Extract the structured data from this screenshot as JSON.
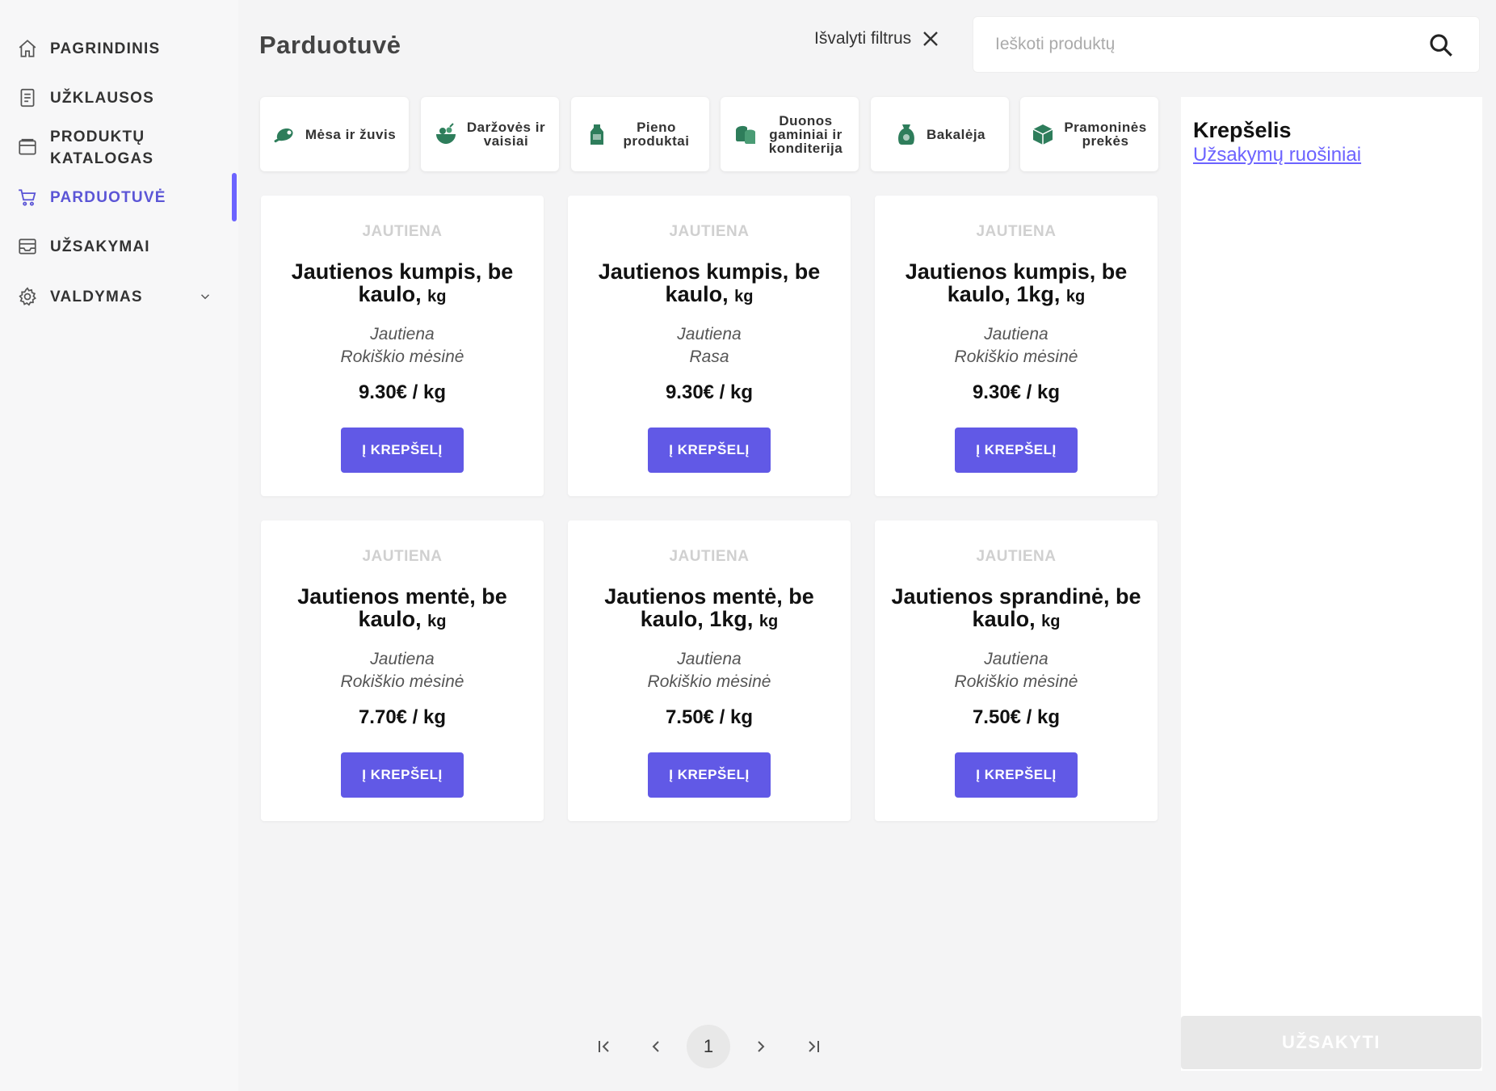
{
  "sidebar": {
    "items": [
      {
        "label": "PAGRINDINIS",
        "icon": "home-icon"
      },
      {
        "label": "UŽKLAUSOS",
        "icon": "document-icon"
      },
      {
        "label": "PRODUKTŲ\nKATALOGAS",
        "icon": "archive-icon"
      },
      {
        "label": "PARDUOTUVĖ",
        "icon": "cart-icon",
        "active": true
      },
      {
        "label": "UŽSAKYMAI",
        "icon": "inbox-icon"
      },
      {
        "label": "VALDYMAS",
        "icon": "gear-icon"
      }
    ]
  },
  "header": {
    "title": "Parduotuvė",
    "clear_filters": "Išvalyti filtrus",
    "search_placeholder": "Ieškoti produktų"
  },
  "categories": [
    {
      "label": "Mėsa ir žuvis",
      "icon": "meat-icon"
    },
    {
      "label": "Daržovės ir vaisiai",
      "icon": "vegetable-bowl-icon"
    },
    {
      "label": "Pieno produktai",
      "icon": "milk-carton-icon"
    },
    {
      "label": "Duonos gaminiai ir konditerija",
      "icon": "bread-icon"
    },
    {
      "label": "Bakalėja",
      "icon": "sack-icon"
    },
    {
      "label": "Pramoninės prekės",
      "icon": "box-icon"
    }
  ],
  "products": [
    {
      "category": "JAUTIENA",
      "name": "Jautienos kumpis, be kaulo,",
      "unit": "kg",
      "type": "Jautiena",
      "supplier": "Rokiškio mėsinė",
      "price": "9.30€ / kg",
      "button": "Į KREPŠELĮ"
    },
    {
      "category": "JAUTIENA",
      "name": "Jautienos kumpis, be kaulo,",
      "unit": "kg",
      "type": "Jautiena",
      "supplier": "Rasa",
      "price": "9.30€ / kg",
      "button": "Į KREPŠELĮ"
    },
    {
      "category": "JAUTIENA",
      "name": "Jautienos kumpis, be kaulo, 1kg,",
      "unit": "kg",
      "type": "Jautiena",
      "supplier": "Rokiškio mėsinė",
      "price": "9.30€ / kg",
      "button": "Į KREPŠELĮ"
    },
    {
      "category": "JAUTIENA",
      "name": "Jautienos mentė, be kaulo,",
      "unit": "kg",
      "type": "Jautiena",
      "supplier": "Rokiškio mėsinė",
      "price": "7.70€ / kg",
      "button": "Į KREPŠELĮ"
    },
    {
      "category": "JAUTIENA",
      "name": "Jautienos mentė, be kaulo, 1kg,",
      "unit": "kg",
      "type": "Jautiena",
      "supplier": "Rokiškio mėsinė",
      "price": "7.50€ / kg",
      "button": "Į KREPŠELĮ"
    },
    {
      "category": "JAUTIENA",
      "name": "Jautienos sprandinė, be kaulo,",
      "unit": "kg",
      "type": "Jautiena",
      "supplier": "Rokiškio mėsinė",
      "price": "7.50€ / kg",
      "button": "Į KREPŠELĮ"
    }
  ],
  "cart": {
    "title": "Krepšelis",
    "link": "Užsakymų ruošiniai",
    "order_button": "UŽSAKYTI"
  },
  "pagination": {
    "current_page": "1"
  },
  "colors": {
    "accent": "#6159e6",
    "active_nav": "#5b55d6",
    "category_icon": "#2e7d5b"
  }
}
